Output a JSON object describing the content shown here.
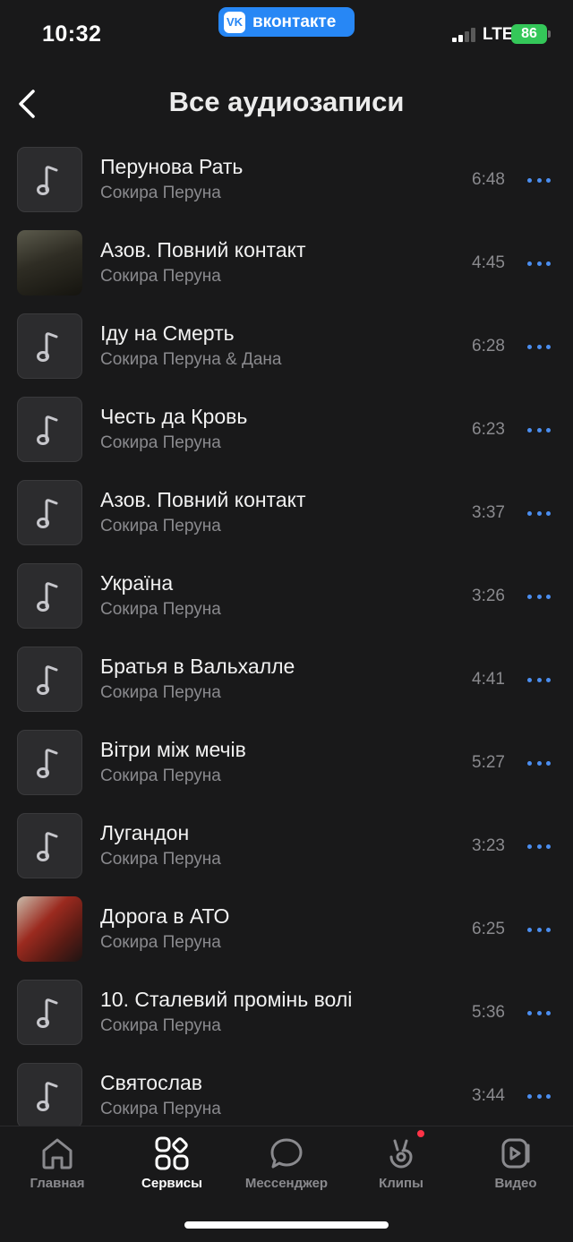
{
  "status": {
    "time": "10:32",
    "app_name": "вконтакте",
    "logo_text": "VK",
    "network": "LTE",
    "battery": "86"
  },
  "header": {
    "title": "Все аудиозаписи"
  },
  "tracks": [
    {
      "title": "Перунова Рать",
      "artist": "Сокира Перуна",
      "duration": "6:48",
      "cover": "note"
    },
    {
      "title": "Азов. Повний контакт",
      "artist": "Сокира Перуна",
      "duration": "4:45",
      "cover": "image-1"
    },
    {
      "title": "Іду на Смерть",
      "artist": "Сокира Перуна & Дана",
      "duration": "6:28",
      "cover": "note"
    },
    {
      "title": "Честь да Кровь",
      "artist": "Сокира Перуна",
      "duration": "6:23",
      "cover": "note"
    },
    {
      "title": "Азов. Повний контакт",
      "artist": "Сокира Перуна",
      "duration": "3:37",
      "cover": "note"
    },
    {
      "title": "Україна",
      "artist": "Сокира Перуна",
      "duration": "3:26",
      "cover": "note"
    },
    {
      "title": "Братья в Вальхалле",
      "artist": "Сокира Перуна",
      "duration": "4:41",
      "cover": "note"
    },
    {
      "title": "Вітри між мечів",
      "artist": "Сокира Перуна",
      "duration": "5:27",
      "cover": "note"
    },
    {
      "title": "Лугандон",
      "artist": "Сокира Перуна",
      "duration": "3:23",
      "cover": "note"
    },
    {
      "title": "Дорога в АТО",
      "artist": "Сокира Перуна",
      "duration": "6:25",
      "cover": "image-2"
    },
    {
      "title": "10. Сталевий промінь волі",
      "artist": "Сокира Перуна",
      "duration": "5:36",
      "cover": "note"
    },
    {
      "title": "Святослав",
      "artist": "Сокира Перуна",
      "duration": "3:44",
      "cover": "note"
    }
  ],
  "tabbar": {
    "items": [
      {
        "label": "Главная",
        "icon": "home-icon"
      },
      {
        "label": "Сервисы",
        "icon": "services-icon"
      },
      {
        "label": "Мессенджер",
        "icon": "messenger-icon"
      },
      {
        "label": "Клипы",
        "icon": "clips-icon"
      },
      {
        "label": "Видео",
        "icon": "video-icon"
      }
    ],
    "active_index": 1
  },
  "colors": {
    "accent": "#2787f5",
    "background": "#19191a",
    "secondary_text": "#8a8a8e",
    "more_dots": "#4b8ef0",
    "battery": "#34c759",
    "notification_dot": "#ff3347"
  }
}
